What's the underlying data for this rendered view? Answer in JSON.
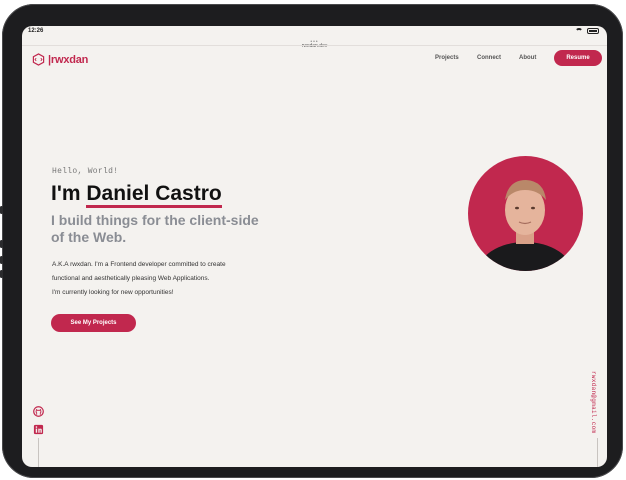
{
  "status": {
    "time": "12:26"
  },
  "browser": {
    "dots": "•••",
    "url": "rwxdan.dev"
  },
  "header": {
    "logo_text": "rwxdan",
    "nav": [
      "Projects",
      "Connect",
      "About"
    ],
    "resume_label": "Resume"
  },
  "hero": {
    "greeting": "Hello, World!",
    "im": "I'm ",
    "name": "Daniel Castro",
    "subtitle_line1": "I build things for the client-side",
    "subtitle_line2": "of the Web.",
    "desc_line1": "A.K.A rwxdan. I'm a Frontend developer committed to create",
    "desc_line2": "functional and aesthetically pleasing Web Applications.",
    "desc_line3": "I'm currently looking for new opportunities!",
    "cta_label": "See My Projects"
  },
  "sidebar": {
    "email": "rwxdan@gmail.com",
    "icons": [
      "github-icon",
      "linkedin-icon"
    ]
  },
  "colors": {
    "accent": "#c1284e",
    "background": "#f4f2ef",
    "text": "#111111",
    "muted": "#8a8d94"
  }
}
